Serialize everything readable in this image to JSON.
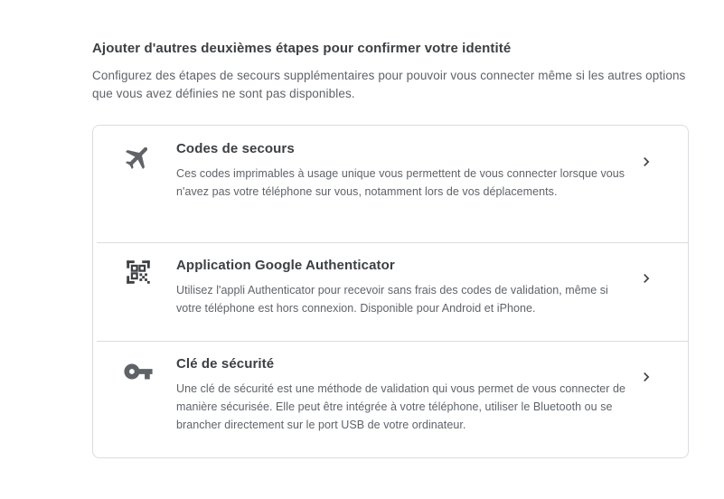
{
  "section": {
    "title": "Ajouter d'autres deuxièmes étapes pour confirmer votre identité",
    "description": "Configurez des étapes de secours supplémentaires pour pouvoir vous connecter même si les autres options que vous avez définies ne sont pas disponibles."
  },
  "options": [
    {
      "icon": "airplane-icon",
      "title": "Codes de secours",
      "description": "Ces codes imprimables à usage unique vous permettent de vous connecter lorsque vous n'avez pas votre téléphone sur vous, notamment lors de vos déplacements."
    },
    {
      "icon": "qr-code-icon",
      "title": "Application Google Authenticator",
      "description": "Utilisez l'appli Authenticator pour recevoir sans frais des codes de validation, même si votre téléphone est hors connexion. Disponible pour Android et iPhone."
    },
    {
      "icon": "key-icon",
      "title": "Clé de sécurité",
      "description": "Une clé de sécurité est une méthode de validation qui vous permet de vous connecter de manière sécurisée. Elle peut être intégrée à votre téléphone, utiliser le Bluetooth ou se brancher directement sur le port USB de votre ordinateur."
    }
  ],
  "colors": {
    "text_primary": "#3c4043",
    "text_secondary": "#5f6368",
    "icon": "#5f6368",
    "divider": "#dadce0"
  }
}
